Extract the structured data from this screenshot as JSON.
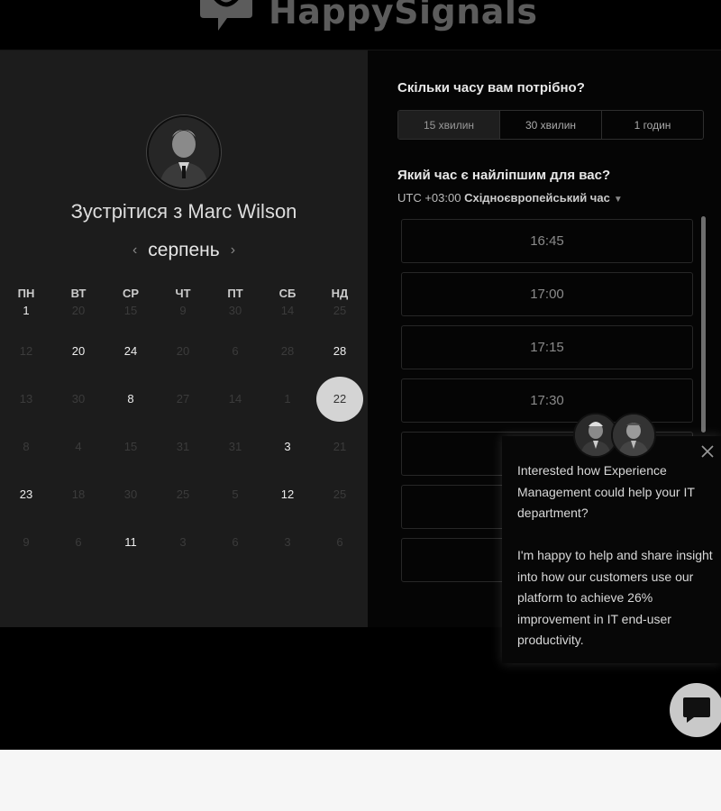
{
  "header": {
    "logo_text": "HappySignals"
  },
  "left": {
    "meet_title": "Зустрітися з Marc Wilson",
    "month": "серпень",
    "prev_icon": "chevron-left-icon",
    "next_icon": "chevron-right-icon",
    "weekdays": [
      "ПН",
      "ВТ",
      "СР",
      "ЧТ",
      "ПТ",
      "СБ",
      "НД"
    ],
    "weeks": [
      [
        "1",
        "20",
        "15",
        "9",
        "30",
        "14",
        "25"
      ],
      [
        "12",
        "20",
        "24",
        "20",
        "6",
        "28",
        "28"
      ],
      [
        "13",
        "30",
        "8",
        "27",
        "14",
        "1",
        "22"
      ],
      [
        "8",
        "4",
        "15",
        "31",
        "31",
        "3",
        "21"
      ],
      [
        "23",
        "18",
        "30",
        "25",
        "5",
        "12",
        "25"
      ],
      [
        "9",
        "6",
        "11",
        "3",
        "6",
        "3",
        "6"
      ]
    ],
    "available": [
      [
        0,
        0
      ],
      [
        1,
        1
      ],
      [
        1,
        2
      ],
      [
        1,
        6
      ],
      [
        2,
        2
      ],
      [
        3,
        5
      ],
      [
        4,
        0
      ],
      [
        4,
        5
      ],
      [
        5,
        2
      ]
    ],
    "selected": [
      2,
      6
    ]
  },
  "right": {
    "question_duration": "Скільки часу вам потрібно?",
    "durations": [
      "15 хвилин",
      "30 хвилин",
      "1 годин"
    ],
    "active_duration_index": 0,
    "question_time": "Який час є найліпшим для вас?",
    "tz_offset": "UTC +03:00",
    "tz_name": "Східноєвропейський час",
    "slots": [
      "16:45",
      "17:00",
      "17:15",
      "17:30",
      "",
      "",
      "",
      ""
    ]
  },
  "chat_popup": {
    "paragraph1": "Interested how Experience Management could help your IT department?",
    "paragraph2": "I'm happy to help and share insight into how our customers use our platform to achieve 26% improvement in IT end-user productivity.",
    "close_icon": "close-icon",
    "launcher_icon": "chat-bubble-icon"
  },
  "colors": {
    "background": "#000000",
    "left_panel": "#1c1c1c",
    "selected_day": "#d4d4d4",
    "footer": "#f6f6f6"
  }
}
